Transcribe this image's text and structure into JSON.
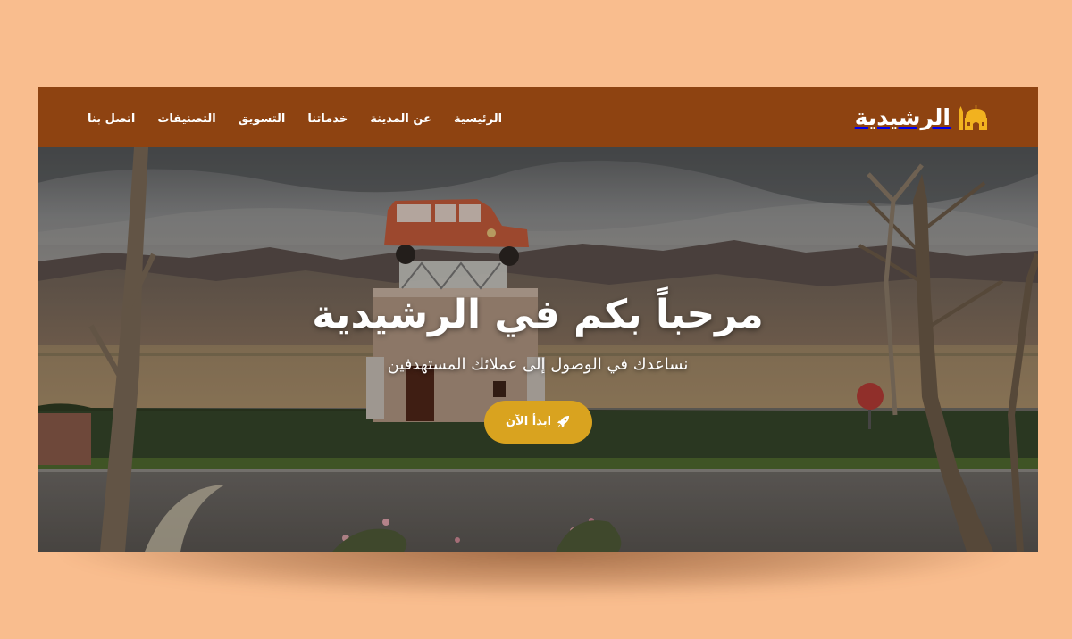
{
  "brand": {
    "name": "الرشيدية",
    "icon": "mosque-icon",
    "color": "#f2b21f"
  },
  "nav": {
    "items": [
      {
        "label": "الرئيسية"
      },
      {
        "label": "عن المدينة"
      },
      {
        "label": "خدماتنا"
      },
      {
        "label": "التسويق"
      },
      {
        "label": "التصنيفات"
      },
      {
        "label": "اتصل بنا"
      }
    ]
  },
  "hero": {
    "title": "مرحباً بكم في الرشيدية",
    "subtitle": "نساعدك في الوصول إلى عملائك المستهدفين",
    "cta_label": "ابدأ الآن",
    "cta_icon": "rocket-icon"
  },
  "colors": {
    "page_background": "#f9bd8e",
    "navbar": "#8e4311",
    "accent": "#d9a31f",
    "text": "#ffffff"
  }
}
